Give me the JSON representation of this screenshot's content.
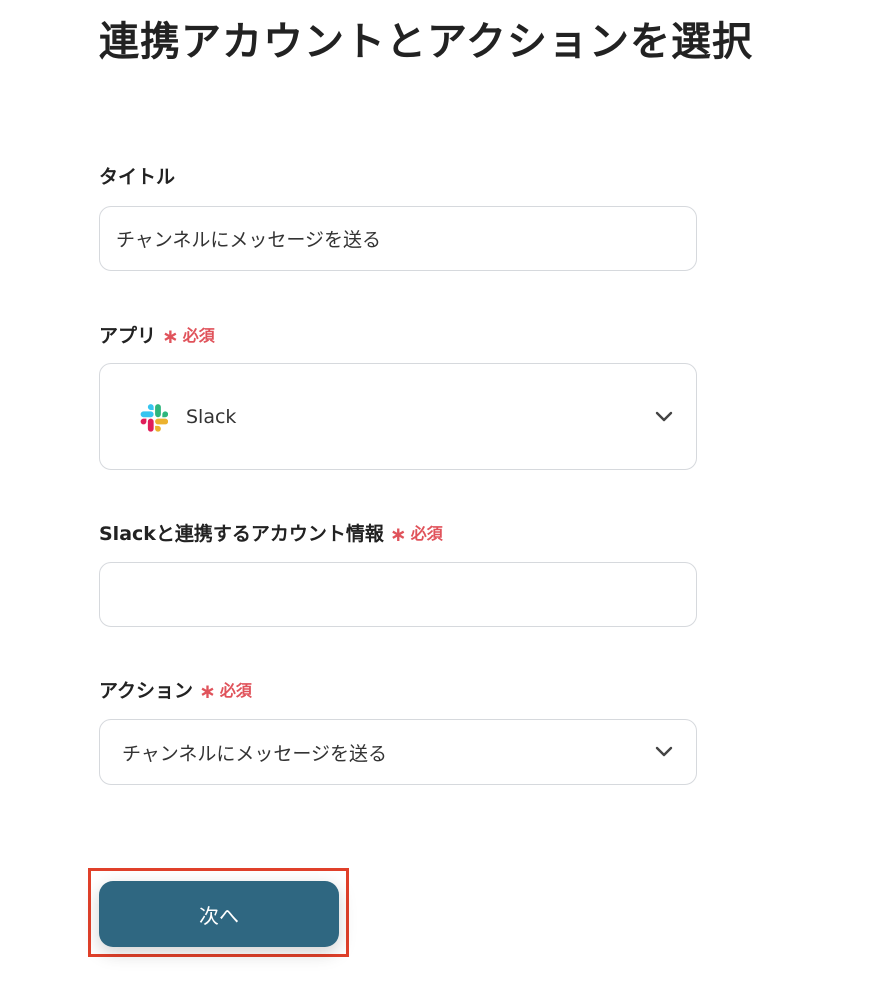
{
  "page": {
    "title": "連携アカウントとアクションを選択"
  },
  "form": {
    "title_field": {
      "label": "タイトル",
      "value": "チャンネルにメッセージを送る"
    },
    "app_field": {
      "label": "アプリ",
      "required_label": "必須",
      "selected_value": "Slack",
      "icon": "slack-logo-icon"
    },
    "account_field": {
      "label": "Slackと連携するアカウント情報",
      "required_label": "必須",
      "value": ""
    },
    "action_field": {
      "label": "アクション",
      "required_label": "必須",
      "selected_value": "チャンネルにメッセージを送る"
    }
  },
  "footer": {
    "next_label": "次へ"
  },
  "colors": {
    "required": "#e0535b",
    "primary_button": "#2f6781",
    "highlight_border": "#e0402a",
    "input_border": "#d6d9dd",
    "slack_blue": "#36c5f0",
    "slack_green": "#2eb67d",
    "slack_yellow": "#ecb22e",
    "slack_red": "#e01e5a"
  }
}
